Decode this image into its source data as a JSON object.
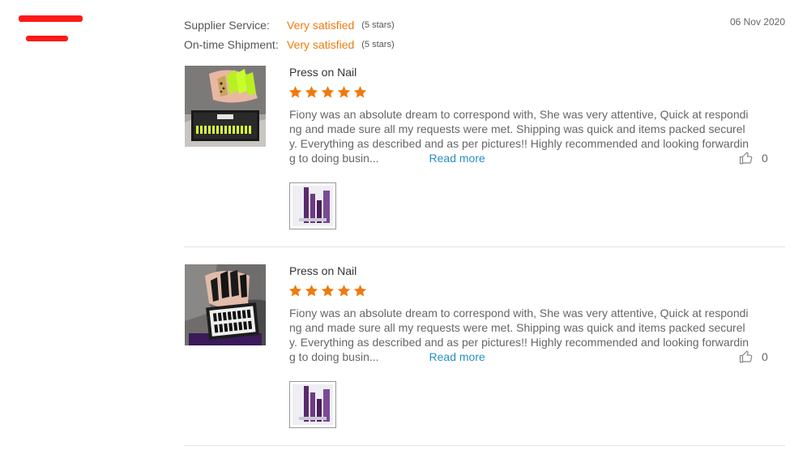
{
  "colors": {
    "accent": "#f07a10",
    "link": "#2a8fc1",
    "star": "#f07a10",
    "redaction": "#ff1a1a"
  },
  "ratings": [
    {
      "label": "Supplier Service:",
      "value": "Very satisfied",
      "stars_text": "(5 stars)"
    },
    {
      "label": "On-time Shipment:",
      "value": "Very satisfied",
      "stars_text": "(5 stars)"
    }
  ],
  "date": "06 Nov 2020",
  "reviews": [
    {
      "product": "Press on Nail",
      "rating": 5,
      "text_lines": [
        "Fiony was an absolute dream to correspond with, She was very attentive, Quick at respondi",
        "ng and made sure all my requests were met. Shipping was quick and items packed securel",
        "y. Everything as described and as per pictures!! Highly recommended and looking forwardin",
        "g to doing busin..."
      ],
      "read_more": "Read more",
      "helpful_count": "0",
      "thumb_icon": "nail-product-photo-neon",
      "attachment_icon": "attachment-photo-icon"
    },
    {
      "product": "Press on Nail",
      "rating": 5,
      "text_lines": [
        "Fiony was an absolute dream to correspond with, She was very attentive, Quick at respondi",
        "ng and made sure all my requests were met. Shipping was quick and items packed securel",
        "y. Everything as described and as per pictures!! Highly recommended and looking forwardin",
        "g to doing busin..."
      ],
      "read_more": "Read more",
      "helpful_count": "0",
      "thumb_icon": "nail-product-photo-black",
      "attachment_icon": "attachment-photo-icon"
    }
  ]
}
